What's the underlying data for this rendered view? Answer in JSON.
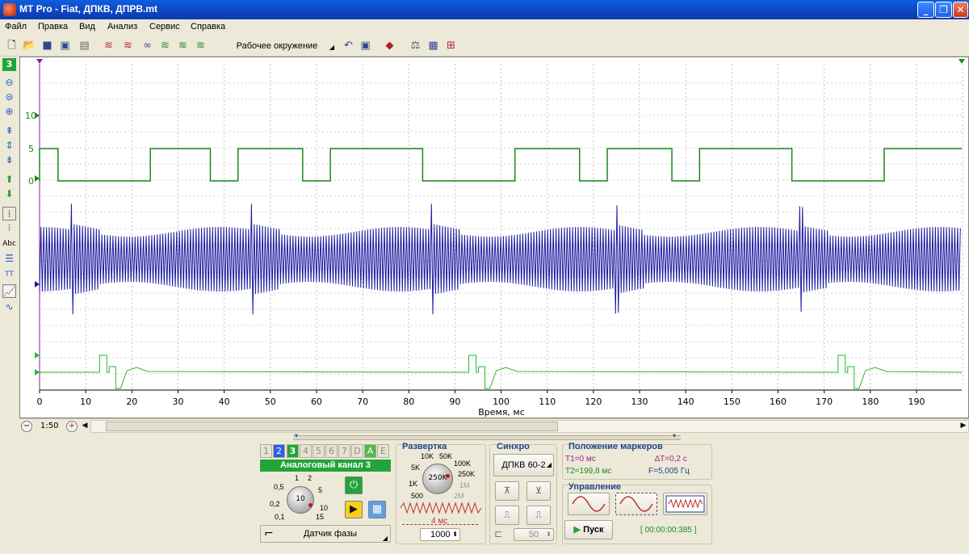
{
  "window": {
    "title": "MT Pro - Fiat, ДПКВ, ДПРВ.mt"
  },
  "menu": [
    "Файл",
    "Правка",
    "Вид",
    "Анализ",
    "Сервис",
    "Справка"
  ],
  "toolbar": {
    "environment_label": "Рабочее окружение"
  },
  "left_toolbar": {
    "channel_badge": "3"
  },
  "plot": {
    "y_ticks": [
      "10",
      "5",
      "0"
    ],
    "x_ticks": [
      "0",
      "10",
      "20",
      "30",
      "40",
      "50",
      "60",
      "70",
      "80",
      "90",
      "100",
      "110",
      "120",
      "130",
      "140",
      "150",
      "160",
      "170",
      "180",
      "190"
    ],
    "x_label": "Время, мс",
    "trace_colors": {
      "ch3": "#1a8a1a",
      "ch2": "#1a1aa0",
      "ch1": "#22bb22"
    }
  },
  "chart_data": {
    "type": "line",
    "xlabel": "Время, мс",
    "xlim": [
      0,
      199.8
    ],
    "series": [
      {
        "color": "#1a8a1a",
        "shape": "square pulses",
        "levels": [
          5,
          0
        ],
        "high_intervals_ms": [
          [
            0,
            4
          ],
          [
            24,
            37
          ],
          [
            43,
            57
          ],
          [
            63,
            83
          ],
          [
            103,
            117
          ],
          [
            123,
            137
          ],
          [
            143,
            163
          ],
          [
            183,
            199.8
          ]
        ]
      },
      {
        "color": "#1a1aa0",
        "shape": "oscillating signal with periodic spikes",
        "spike_times_ms": [
          7,
          46,
          85,
          125,
          165
        ]
      },
      {
        "color": "#22bb22",
        "shape": "pulses",
        "pulse_times_ms": [
          13,
          93,
          173
        ]
      }
    ]
  },
  "scroll": {
    "zoom_label": "1:50"
  },
  "channel_panel": {
    "tabs": [
      "1",
      "2",
      "3",
      "4",
      "5",
      "6",
      "7",
      "D",
      "A",
      "E"
    ],
    "name": "Аналоговый канал 3",
    "scale_labels": [
      "1",
      "2",
      "0,5",
      "5",
      "0,2",
      "10",
      "0,1",
      "15"
    ],
    "knob_value": "10",
    "sensor": "Датчик фазы"
  },
  "sweep": {
    "title": "Развертка",
    "scale_labels": [
      "10K",
      "50K",
      "5K",
      "100K",
      "1K",
      "250K",
      "500",
      "1M",
      "2M"
    ],
    "knob_value": "250K",
    "time": "4 мс",
    "points": "1000"
  },
  "sync": {
    "title": "Синхро",
    "source": "ДПКВ 60-2",
    "level": "50"
  },
  "markers": {
    "title": "Положение маркеров",
    "t1": "T1=0 мс",
    "dt": "∆T=0,2 с",
    "t2": "T2=199,8 мс",
    "f": "F=5,005 Гц"
  },
  "control": {
    "title": "Управление",
    "start_label": "Пуск",
    "timer": "[ 00:00:00:385 ]"
  }
}
